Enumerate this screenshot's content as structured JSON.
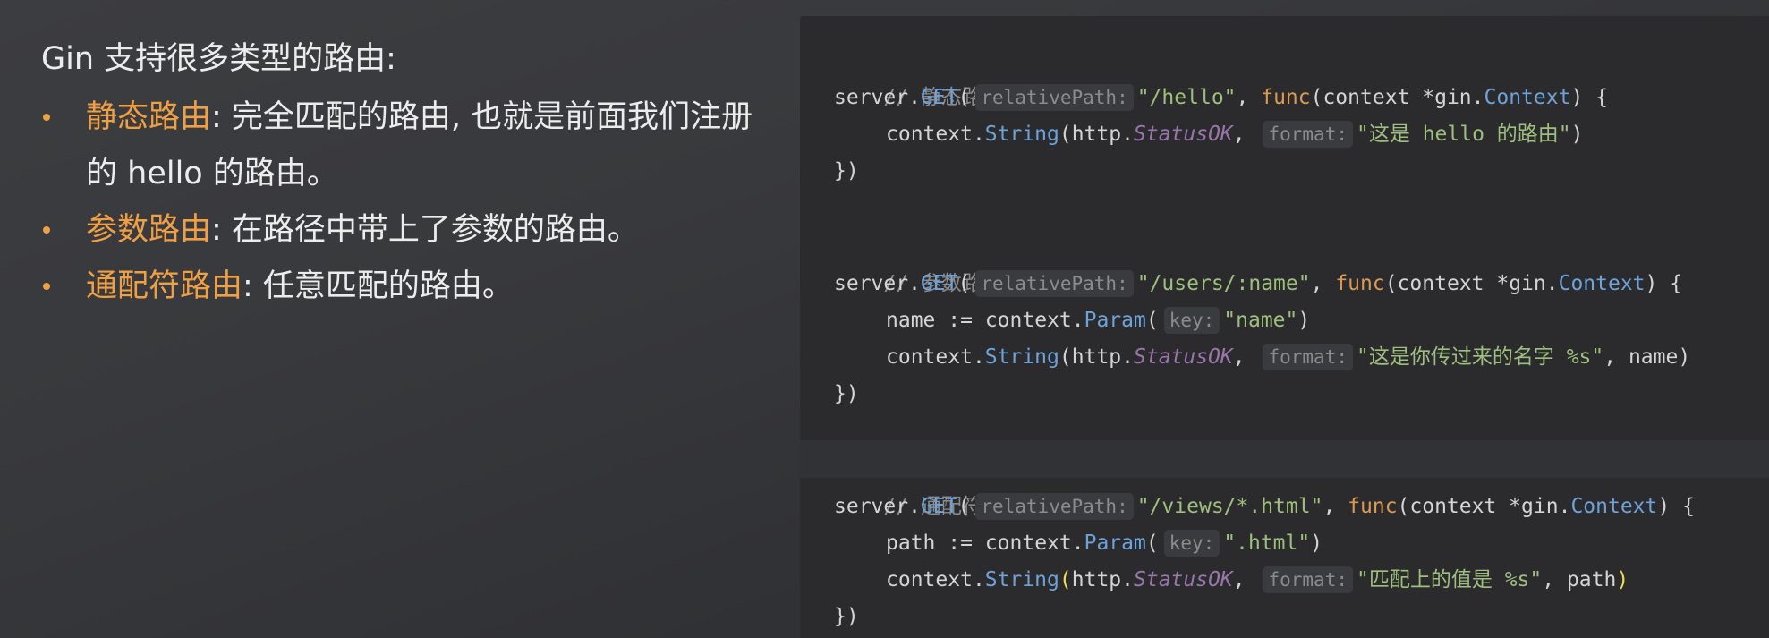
{
  "left": {
    "heading": "Gin 支持很多类型的路由:",
    "items": [
      {
        "term": "静态路由",
        "desc": ": 完全匹配的路由, 也就是前面我们注册的 hello 的路由。"
      },
      {
        "term": "参数路由",
        "desc": ": 在路径中带上了参数的路由。"
      },
      {
        "term": "通配符路由",
        "desc": ": 任意匹配的路由。"
      }
    ]
  },
  "code": {
    "comment1": "// 静态路由",
    "comment2": "// 参数路由",
    "comment3": "// 通配符匹配",
    "server": "server",
    "get": "GET",
    "hint_relative_path": "relativePath:",
    "hint_key": "key:",
    "hint_format": "format:",
    "path_hello": "\"/hello\"",
    "path_users": "\"/users/:name\"",
    "path_views": "\"/views/*.html\"",
    "func_kw": "func",
    "context_param": "(context *",
    "gin_pkg": "gin",
    "context_type": "Context",
    "context_var": "context",
    "string_fn": "String",
    "param_fn": "Param",
    "http_pkg": "http",
    "status_ok": "StatusOK",
    "str_hello": "\"这是 hello 的路由\"",
    "str_name_key": "\"name\"",
    "str_name_fmt": "\"这是你传过来的名字 %s\"",
    "str_html_key": "\".html\"",
    "str_path_fmt": "\"匹配上的值是 %s\"",
    "var_name": "name",
    "var_path": "path",
    "assign": ":=",
    "close_brace": "})",
    "open_brace": "{"
  },
  "colors": {
    "accent": "#f0a044",
    "editor_bg": "#2b2b2d",
    "comment": "#8a8a8a",
    "string": "#9fbf7e",
    "keyword": "#d99a55",
    "function": "#6fa2d8",
    "constant": "#9876aa"
  }
}
